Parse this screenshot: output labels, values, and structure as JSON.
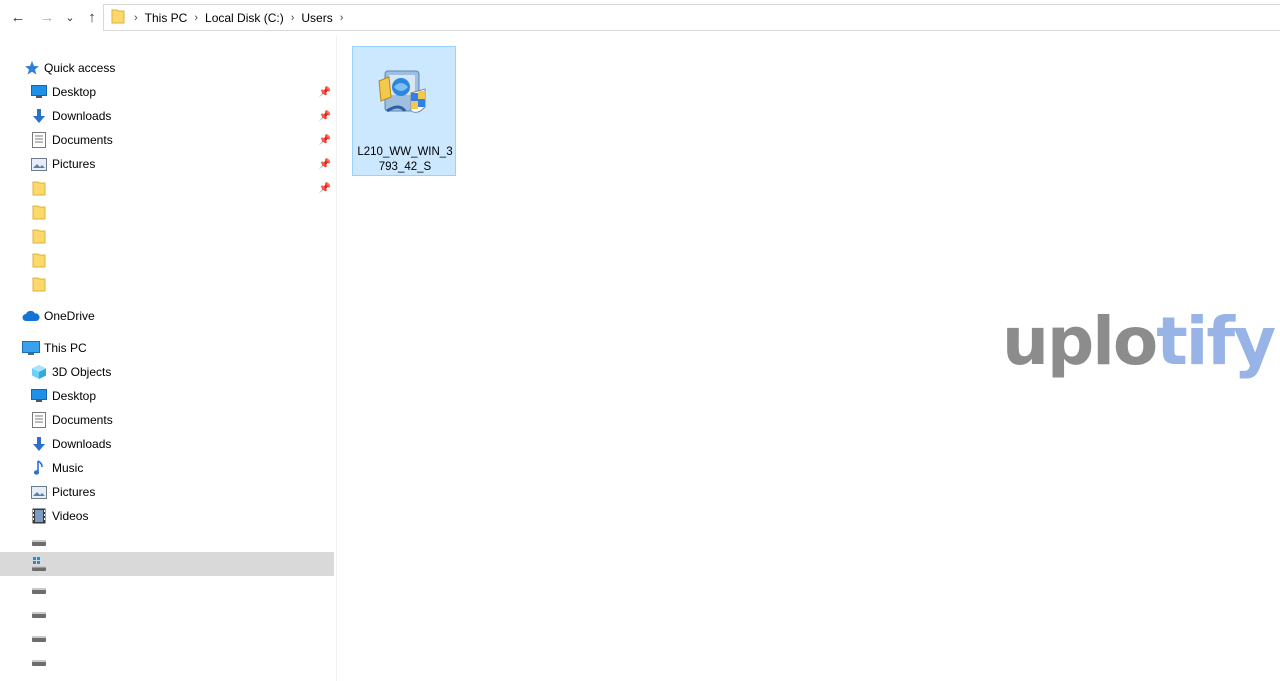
{
  "nav_buttons": {
    "back": "←",
    "forward": "→",
    "recent": "⌄",
    "up": "↑"
  },
  "breadcrumb": [
    "This PC",
    "Local Disk (C:)",
    "Users"
  ],
  "quick_access": {
    "label": "Quick access",
    "items": [
      {
        "label": "Desktop",
        "icon": "desktop-icon",
        "pinned": true
      },
      {
        "label": "Downloads",
        "icon": "downloads-icon",
        "pinned": true
      },
      {
        "label": "Documents",
        "icon": "documents-icon",
        "pinned": true
      },
      {
        "label": "Pictures",
        "icon": "pictures-icon",
        "pinned": true
      },
      {
        "label": "",
        "icon": "folder-icon",
        "pinned": true
      },
      {
        "label": "",
        "icon": "folder-icon",
        "pinned": false
      },
      {
        "label": "",
        "icon": "folder-icon",
        "pinned": false
      },
      {
        "label": "",
        "icon": "folder-icon",
        "pinned": false
      },
      {
        "label": "",
        "icon": "folder-icon",
        "pinned": false
      }
    ]
  },
  "onedrive": {
    "label": "OneDrive"
  },
  "this_pc": {
    "label": "This PC",
    "items": [
      {
        "label": "3D Objects",
        "icon": "3d-objects-icon"
      },
      {
        "label": "Desktop",
        "icon": "desktop-icon"
      },
      {
        "label": "Documents",
        "icon": "documents-icon"
      },
      {
        "label": "Downloads",
        "icon": "downloads-icon"
      },
      {
        "label": "Music",
        "icon": "music-icon"
      },
      {
        "label": "Pictures",
        "icon": "pictures-icon"
      },
      {
        "label": "Videos",
        "icon": "videos-icon"
      }
    ]
  },
  "drives": [
    {
      "label": "",
      "icon": "drive-icon",
      "selected": false
    },
    {
      "label": "",
      "icon": "windows-drive-icon",
      "selected": true
    },
    {
      "label": "",
      "icon": "drive-icon",
      "selected": false
    },
    {
      "label": "",
      "icon": "drive-icon",
      "selected": false
    },
    {
      "label": "",
      "icon": "drive-icon",
      "selected": false
    },
    {
      "label": "",
      "icon": "drive-icon",
      "selected": false
    }
  ],
  "content": {
    "files": [
      {
        "name": "L210_WW_WIN_3793_42_S",
        "icon": "installer-icon",
        "selected": true
      }
    ]
  },
  "watermark": {
    "part1": "uplo",
    "part2": "tify"
  },
  "colors": {
    "selection": "#cce8ff",
    "selection_border": "#99d1ff",
    "nav_selected": "#d9d9d9",
    "watermark_gray": "#8c8c8c",
    "watermark_blue": "#98b3e6"
  }
}
